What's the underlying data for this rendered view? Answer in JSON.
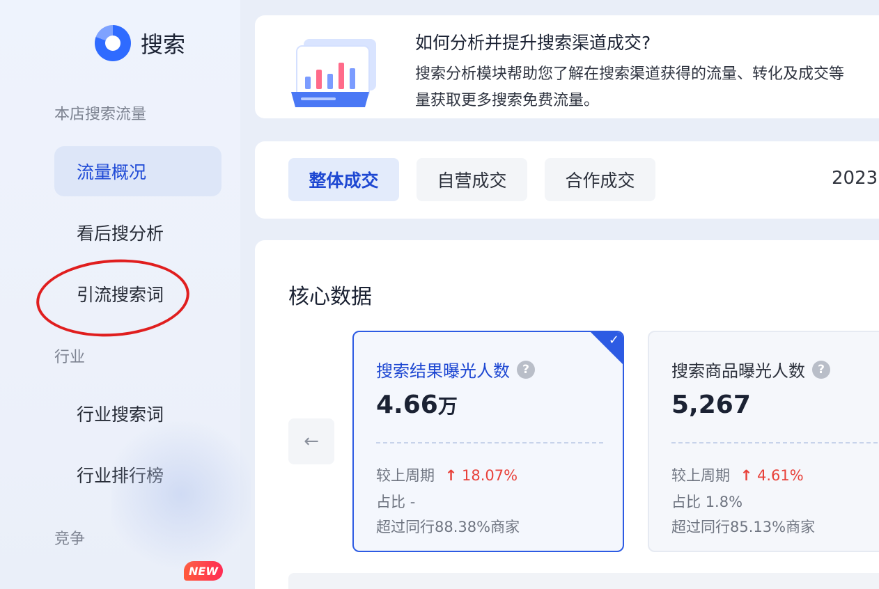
{
  "sidebar": {
    "app_title": "搜索",
    "logo_icon": "search-logo-icon",
    "groups": [
      {
        "label": "本店搜索流量"
      },
      {
        "label": "行业"
      },
      {
        "label": "竞争"
      }
    ],
    "items": [
      {
        "label": "流量概况",
        "active": true
      },
      {
        "label": "看后搜分析",
        "active": false
      },
      {
        "label": "引流搜索词",
        "active": false,
        "circled": true
      },
      {
        "label": "行业搜索词",
        "active": false
      },
      {
        "label": "行业排行榜",
        "active": false
      }
    ],
    "new_badge": "NEW"
  },
  "banner": {
    "title": "如何分析并提升搜索渠道成交?",
    "desc_line1": "搜索分析模块帮助您了解在搜索渠道获得的流量、转化及成交等",
    "desc_line2": "量获取更多搜索免费流量。"
  },
  "tabs": {
    "items": [
      {
        "label": "整体成交",
        "active": true
      },
      {
        "label": "自营成交",
        "active": false
      },
      {
        "label": "合作成交",
        "active": false
      }
    ],
    "date": "2023,"
  },
  "core": {
    "title": "核心数据",
    "prev_arrow": "←",
    "metrics": [
      {
        "name": "搜索结果曝光人数",
        "value": "4.66",
        "unit": "万",
        "compare_label": "较上周期",
        "compare_value": "18.07%",
        "share_label": "占比",
        "share_value": "-",
        "beat_text": "超过同行88.38%商家",
        "selected": true
      },
      {
        "name": "搜索商品曝光人数",
        "value": "5,267",
        "unit": "",
        "compare_label": "较上周期",
        "compare_value": "4.61%",
        "share_label": "占比",
        "share_value": "1.8%",
        "beat_text": "超过同行85.13%商家",
        "selected": false
      }
    ]
  },
  "colors": {
    "accent": "#2d5be3",
    "increase": "#e8413a",
    "annotation_ring": "#e01e1e"
  }
}
